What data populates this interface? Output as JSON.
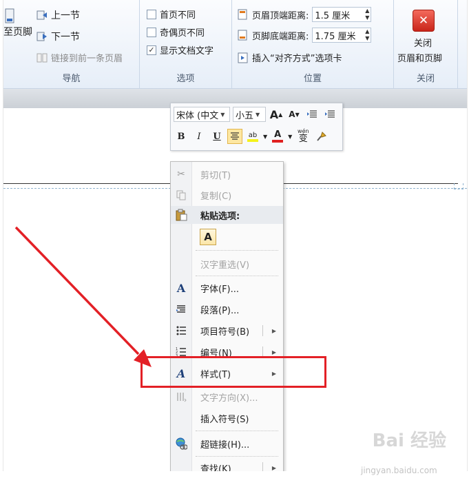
{
  "ribbon": {
    "nav_group": {
      "goto_footer_label": "至页脚",
      "previous_label": "上一节",
      "next_label": "下一节",
      "link_previous_label": "链接到前一条页眉",
      "group_label": "导航"
    },
    "options_group": {
      "different_first_page": {
        "label": "首页不同",
        "checked": false
      },
      "different_odd_even": {
        "label": "奇偶页不同",
        "checked": false
      },
      "show_document_text": {
        "label": "显示文档文字",
        "checked": true
      },
      "group_label": "选项"
    },
    "position_group": {
      "header_from_top_label": "页眉顶端距离:",
      "header_from_top_value": "1.5 厘米",
      "footer_from_bottom_label": "页脚底端距离:",
      "footer_from_bottom_value": "1.75 厘米",
      "insert_align_tab_label": "插入“对齐方式”选项卡",
      "group_label": "位置"
    },
    "close_group": {
      "close_label_line1": "关闭",
      "close_label_line2": "页眉和页脚",
      "group_label": "关闭"
    }
  },
  "mini_toolbar": {
    "font_name": "宋体 (中文",
    "font_size": "小五",
    "grow_font": "A",
    "shrink_font": "A",
    "bold": "B",
    "italic": "I",
    "underline": "U",
    "highlight_text": "ab",
    "font_color_text": "A",
    "phonetic_text": "wén",
    "phonetic_char": "变"
  },
  "context_menu": {
    "items": [
      {
        "label": "剪切(T)",
        "enabled": false
      },
      {
        "label": "复制(C)",
        "enabled": false
      },
      {
        "label": "粘贴选项:",
        "enabled": true
      },
      {
        "label": "A",
        "enabled": true
      },
      {
        "label": "汉字重选(V)",
        "enabled": false
      },
      {
        "label": "字体(F)...",
        "enabled": true
      },
      {
        "label": "段落(P)...",
        "enabled": true
      },
      {
        "label": "项目符号(B)",
        "enabled": true,
        "submenu": true
      },
      {
        "label": "编号(N)",
        "enabled": true,
        "submenu": true
      },
      {
        "label": "样式(T)",
        "enabled": true,
        "submenu": true
      },
      {
        "label": "文字方向(X)...",
        "enabled": false
      },
      {
        "label": "插入符号(S)",
        "enabled": true
      },
      {
        "label": "超链接(H)...",
        "enabled": true
      },
      {
        "label": "查找(K)",
        "enabled": true,
        "submenu": true
      }
    ]
  },
  "watermark": {
    "brand": "Bai 经验",
    "url": "jingyan.baidu.com"
  },
  "colors": {
    "highlight_red": "#e32026",
    "close_red": "#d6372b"
  }
}
